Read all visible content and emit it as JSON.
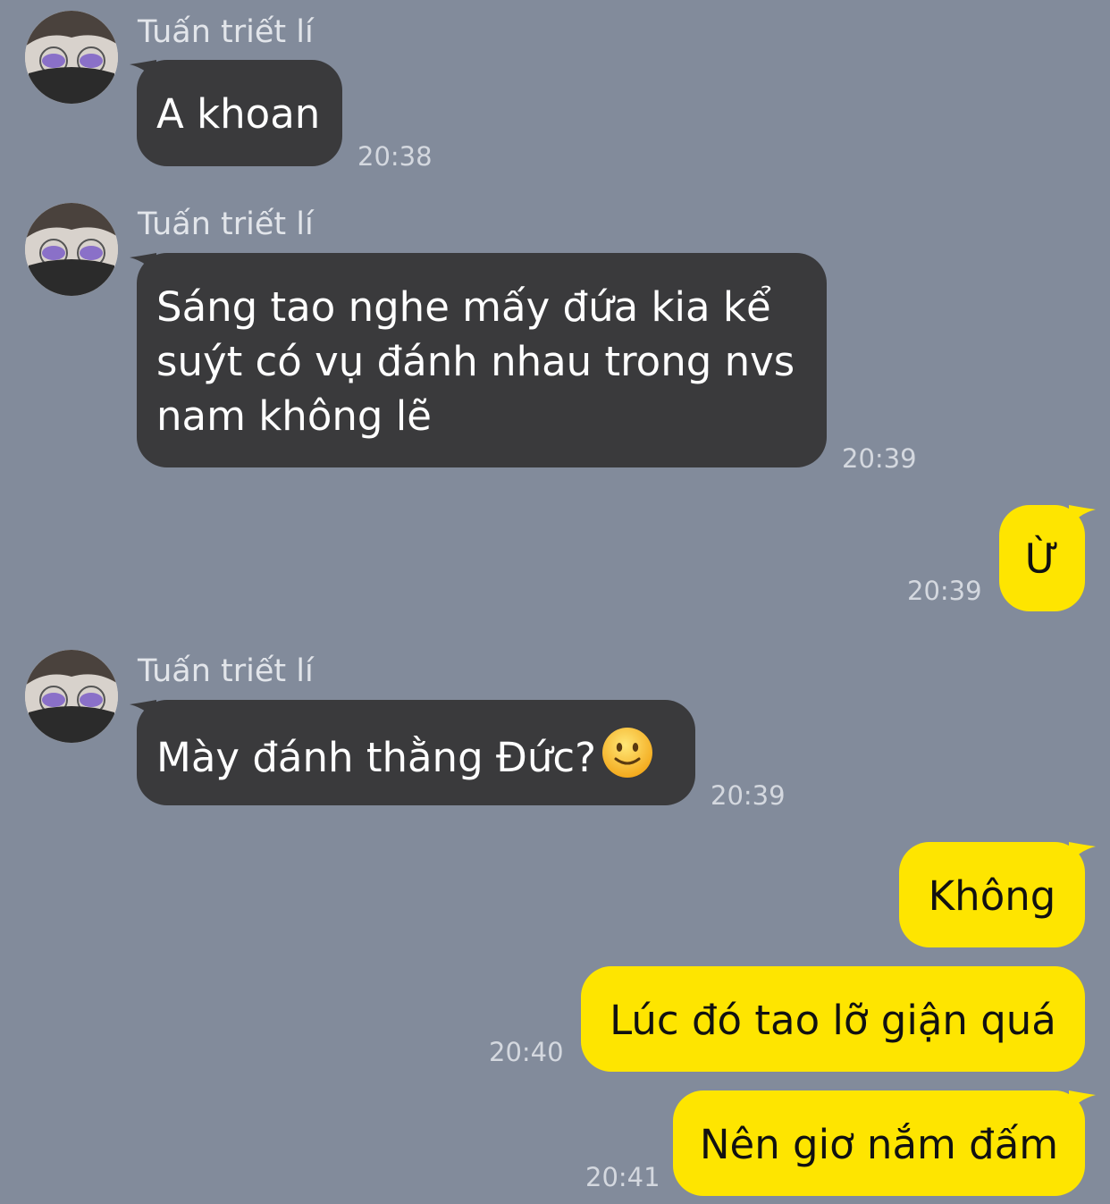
{
  "sender_name": "Tuấn triết lí",
  "emoji_icon": "slightly-smiling-face-emoji",
  "messages": [
    {
      "direction": "incoming",
      "show_sender": true,
      "text": "A khoan",
      "time": "20:38"
    },
    {
      "direction": "incoming",
      "show_sender": true,
      "lines": [
        "Sáng tao nghe mấy đứa kia kể",
        "suýt có vụ đánh nhau trong nvs",
        "nam không lẽ"
      ],
      "time": "20:39"
    },
    {
      "direction": "outgoing",
      "text": "Ừ",
      "time": "20:39"
    },
    {
      "direction": "incoming",
      "show_sender": true,
      "text": "Mày đánh thằng Đức?",
      "time": "20:39"
    },
    {
      "direction": "outgoing",
      "text": "Không",
      "time": ""
    },
    {
      "direction": "outgoing",
      "text": "Lúc đó tao lỡ giận quá",
      "time": "20:40"
    },
    {
      "direction": "outgoing",
      "text": "Nên giơ nắm đấm",
      "time": "20:41"
    }
  ],
  "colors": {
    "background": "#828b9b",
    "incoming_bubble": "#3a3a3c",
    "outgoing_bubble": "#fee500"
  }
}
